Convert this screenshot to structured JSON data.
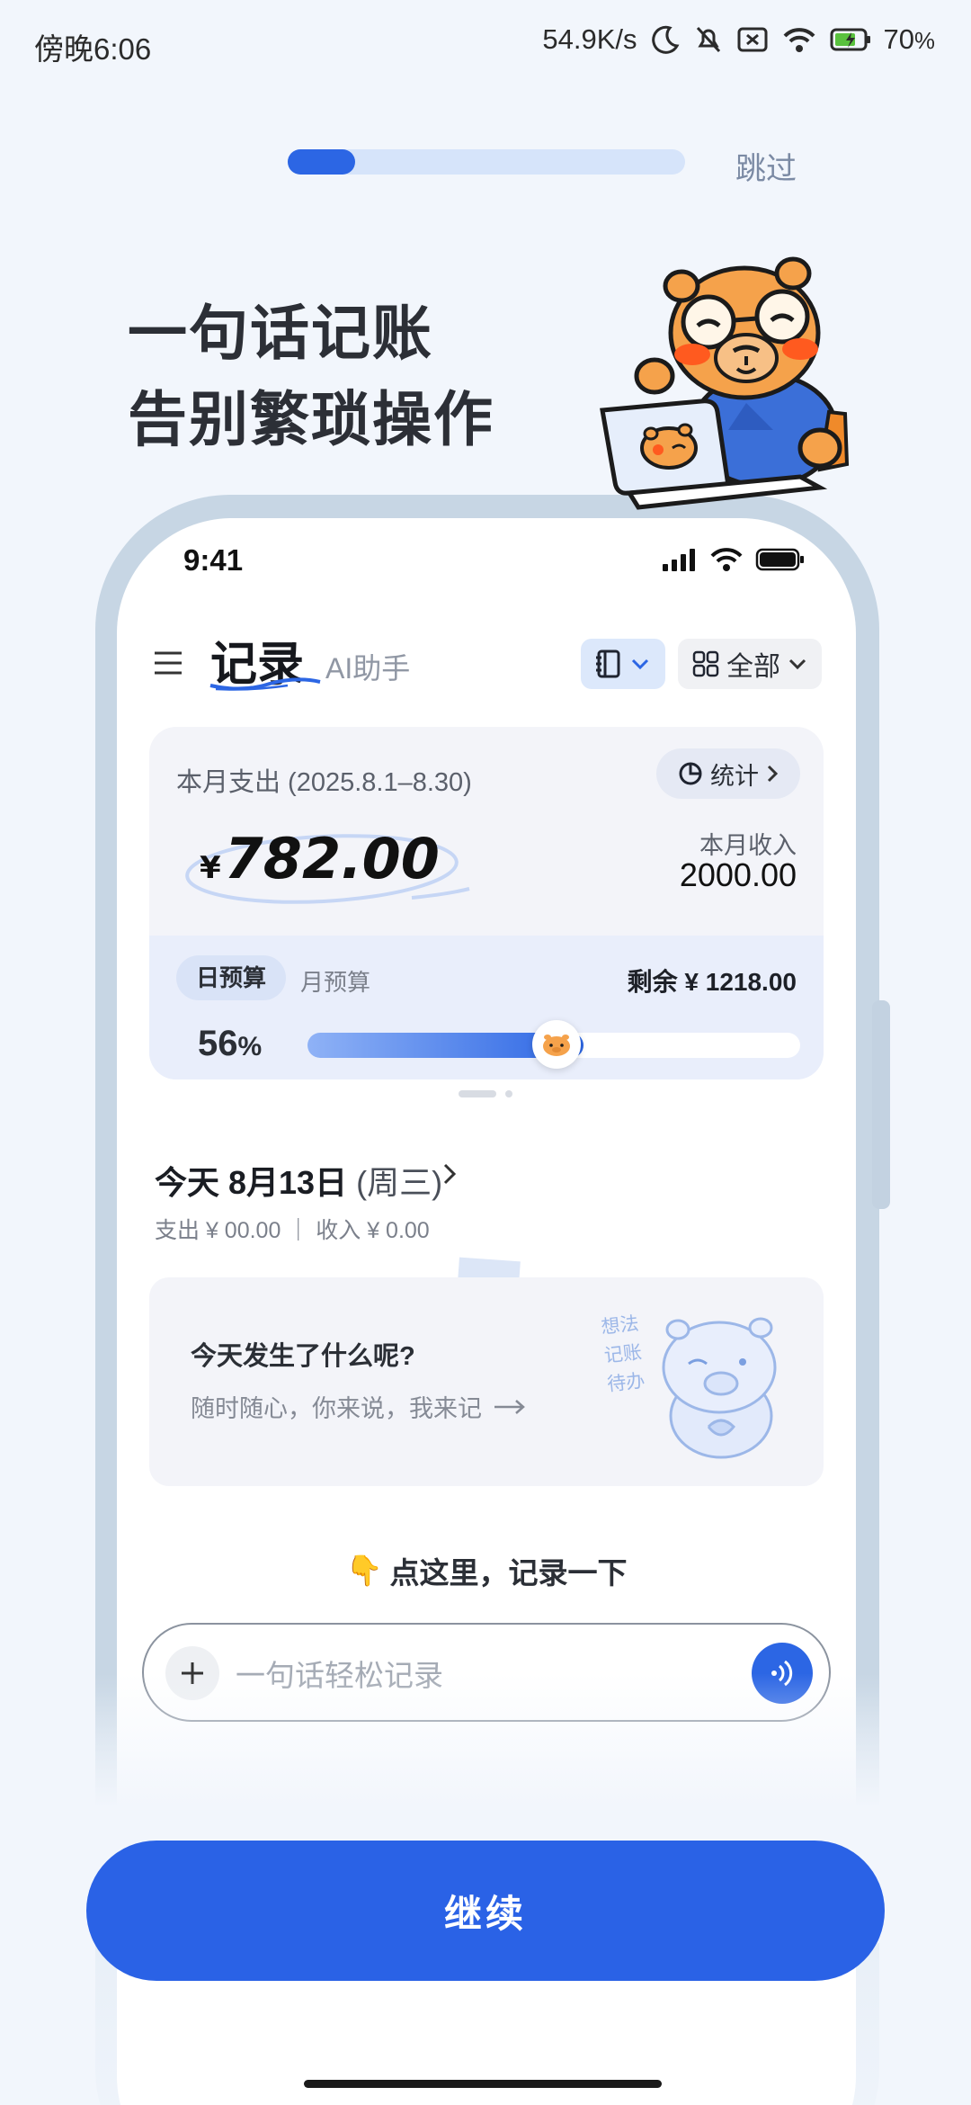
{
  "status_bar": {
    "time": "傍晚6:06",
    "network_speed": "54.9K/s",
    "battery": "70"
  },
  "onboarding": {
    "progress": 0.17,
    "skip_label": "跳过",
    "headline_line1": "一句话记账",
    "headline_line2": "告别繁琐操作",
    "continue_label": "继续"
  },
  "mock_phone": {
    "status_time": "9:41",
    "tabs": {
      "record": "记录",
      "ai": "AI助手"
    },
    "filter_label": "全部",
    "summary": {
      "title": "本月支出 (2025.8.1–8.30)",
      "stats_label": "统计",
      "currency_symbol": "¥",
      "amount": "782.00",
      "income_label": "本月收入",
      "income_value": "2000.00",
      "budget_daily": "日预算",
      "budget_monthly": "月预算",
      "remaining": "剩余 ¥ 1218.00",
      "percent_value": "56",
      "percent_sign": "%",
      "percent_fill": 0.56
    },
    "today": {
      "title": "今天 8月13日",
      "weekday": "(周三)",
      "summary": "支出 ¥ 00.00 ｜ 收入 ¥ 0.00"
    },
    "prompt_card": {
      "title": "今天发生了什么呢?",
      "subtitle": "随时随心，你来说，我来记",
      "tag1": "想法",
      "tag2": "记账",
      "tag3": "待办"
    },
    "hint_emoji": "👇",
    "hint": "点这里，记录一下",
    "input_placeholder": "一句话轻松记录"
  },
  "colors": {
    "accent": "#2a62e6",
    "background": "#f2f6fc",
    "mascot_orange": "#f5a24b",
    "mascot_blue": "#3b6fd8"
  }
}
